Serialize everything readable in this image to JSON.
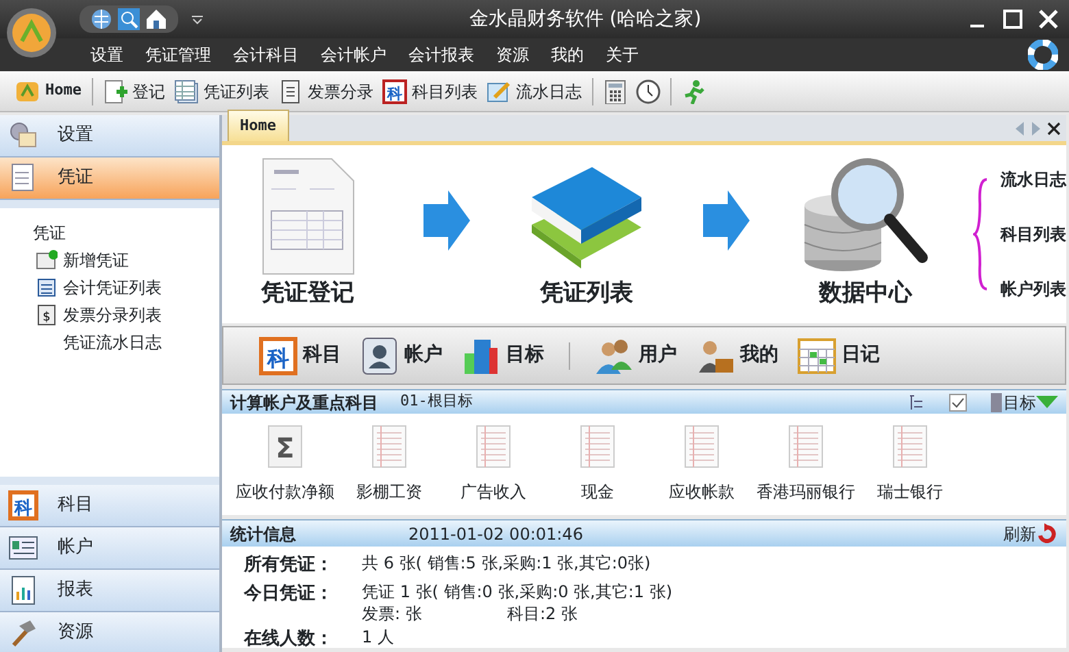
{
  "window": {
    "title": "金水晶财务软件 (哈哈之家)"
  },
  "menu": [
    "设置",
    "凭证管理",
    "会计科目",
    "会计帐户",
    "会计报表",
    "资源",
    "我的",
    "关于"
  ],
  "toolbar": [
    {
      "label": "Home",
      "kind": "home"
    },
    {
      "label": "登记",
      "kind": "add"
    },
    {
      "label": "凭证列表",
      "kind": "list"
    },
    {
      "label": "发票分录",
      "kind": "doc"
    },
    {
      "label": "科目列表",
      "kind": "subject",
      "icon_text": "科"
    },
    {
      "label": "流水日志",
      "kind": "note"
    },
    {
      "kind": "calc"
    },
    {
      "kind": "clock"
    },
    {
      "kind": "run"
    }
  ],
  "sidebar": {
    "top": [
      {
        "label": "设置",
        "selected": false
      },
      {
        "label": "凭证",
        "selected": true
      }
    ],
    "tree": {
      "label": "凭证",
      "children": [
        {
          "label": "新增凭证"
        },
        {
          "label": "会计凭证列表"
        },
        {
          "label": "发票分录列表",
          "icon_text": "$"
        },
        {
          "label": "凭证流水日志"
        }
      ]
    },
    "bottom": [
      {
        "label": "科目",
        "selected": false,
        "icon_text": "科"
      },
      {
        "label": "帐户",
        "selected": false
      },
      {
        "label": "报表",
        "selected": false
      },
      {
        "label": "资源",
        "selected": false
      }
    ]
  },
  "tabs": [
    {
      "label": "Home",
      "selected": true
    }
  ],
  "flow": {
    "steps": [
      "凭证登记",
      "凭证列表",
      "数据中心"
    ],
    "links": [
      "流水日志",
      "科目列表",
      "帐户列表"
    ]
  },
  "modules": [
    {
      "label": "科目",
      "icon_text": "科"
    },
    {
      "label": "帐户"
    },
    {
      "label": "目标"
    },
    {
      "label": "用户"
    },
    {
      "label": "我的"
    },
    {
      "label": "日记"
    }
  ],
  "accounts": {
    "title": "计算帐户及重点科目",
    "subtitle": "01-根目标",
    "filter": "目标",
    "items": [
      {
        "label": "应收付款净额",
        "kind": "sum",
        "icon_text": "Σ"
      },
      {
        "label": "影棚工资",
        "kind": "ledger"
      },
      {
        "label": "广告收入",
        "kind": "ledger"
      },
      {
        "label": "现金",
        "kind": "ledger"
      },
      {
        "label": "应收帐款",
        "kind": "ledger"
      },
      {
        "label": "香港玛丽银行",
        "kind": "ledger"
      },
      {
        "label": "瑞士银行",
        "kind": "ledger"
      }
    ]
  },
  "stats": {
    "title": "统计信息",
    "timestamp": "2011-01-02 00:01:46",
    "refresh": "刷新",
    "rows": [
      {
        "label": "所有凭证：",
        "lines": [
          [
            "共 6 张( 销售:5 张,采购:1 张,其它:0张)"
          ]
        ]
      },
      {
        "label": "今日凭证：",
        "lines": [
          [
            "凭证 1 张( 销售:0 张,采购:0 张,其它:1 张)"
          ],
          [
            "发票: 张",
            "科目:2 张"
          ]
        ]
      },
      {
        "label": "在线人数：",
        "lines": [
          [
            "1 人"
          ]
        ]
      }
    ]
  }
}
